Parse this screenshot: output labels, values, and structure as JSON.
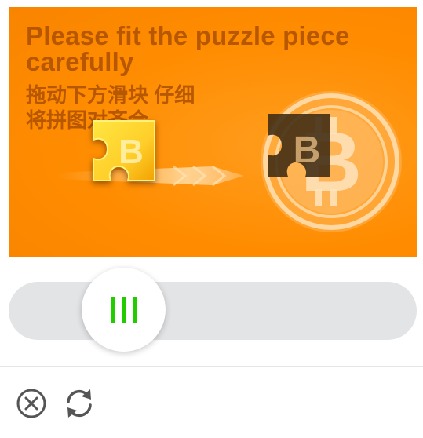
{
  "captcha": {
    "title_en": "Please fit the puzzle piece carefully",
    "title_cn": "拖动下方滑块 仔细将拼图对齐合"
  },
  "colors": {
    "background_orange": "#ff8c00",
    "title_text": "#a84d00",
    "coin": "#ffd39a",
    "piece_yellow": "#ffe640",
    "hole_dark": "#3d2a12",
    "track": "#e3e4e6",
    "grip_green": "#22cc00",
    "icon_gray": "#555555"
  },
  "slider": {
    "position_fraction": 0.23,
    "handle_icon": "grip-bars-icon"
  },
  "footer": {
    "close_icon": "close-circle-icon",
    "refresh_icon": "refresh-icon"
  }
}
